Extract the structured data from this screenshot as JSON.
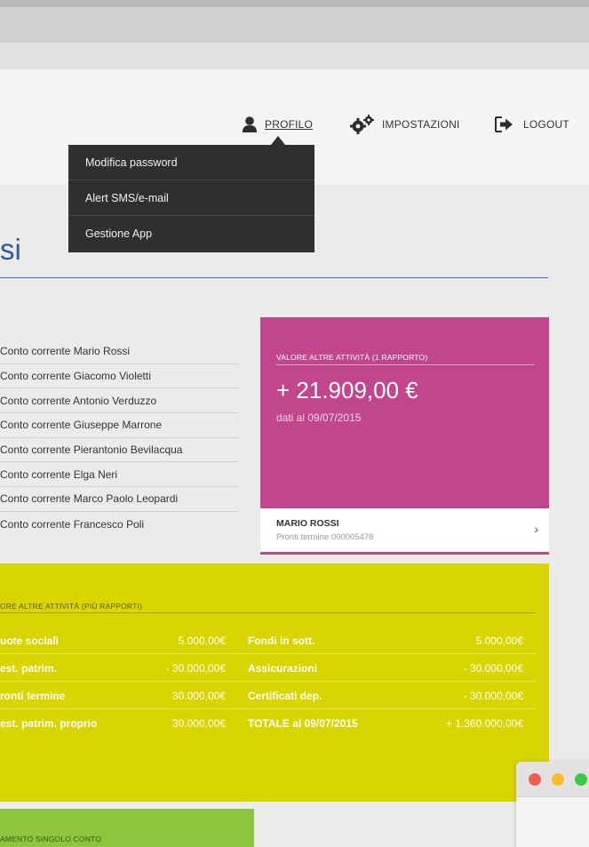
{
  "nav": {
    "profilo": "PROFILO",
    "impostazioni": "IMPOSTAZIONI",
    "logout": "LOGOUT"
  },
  "dropdown": {
    "items": [
      "Modifica password",
      "Alert SMS/e-mail",
      "Gestione App"
    ]
  },
  "page": {
    "title": "si"
  },
  "accounts": [
    "Conto corrente Mario Rossi",
    "Conto corrente Giacomo Violetti",
    "Conto corrente Antonio Verduzzo",
    "Conto corrente Giuseppe Marrone",
    "Conto corrente Pierantonio Bevilacqua",
    "Conto corrente Elga Neri",
    "Conto corrente Marco Paolo Leopardi",
    "Conto corrente Francesco Poli"
  ],
  "card": {
    "label": "VALORE ALTRE ATTIVITÀ (1 RAPPORTO)",
    "value": "+ 21.909,00 €",
    "date": "dati al 09/07/2015",
    "name": "MARIO ROSSI",
    "sub": "Pronti termine 000005478",
    "chevron": "›",
    "color": "#c2468b"
  },
  "panel_yellow": {
    "label": "ORE ALTRE ATTIVITÀ (PIÙ RAPPORTI)",
    "color": "#d9d500",
    "rows": [
      {
        "l1": "uote sociali",
        "v1": "5.000,00€",
        "l2": "Fondi in sott.",
        "v2": "5.000,00€"
      },
      {
        "l1": "est. patrim.",
        "v1": "- 30.000,00€",
        "l2": "Assicurazioni",
        "v2": "- 30.000,00€"
      },
      {
        "l1": "ronti termine",
        "v1": "30.000,00€",
        "l2": "Certificati dep.",
        "v2": "- 30.000,00€"
      },
      {
        "l1": "est. patrim. proprio",
        "v1": "30.000,00€",
        "l2": "TOTALE al 09/07/2015",
        "v2": "+ 1.360.000,00€"
      }
    ]
  },
  "panel_green": {
    "label": "AMENTO SINGOLO CONTO",
    "color": "#8cc63e"
  },
  "icons": {
    "profilo": "user-icon",
    "impostazioni": "gears-icon",
    "logout": "logout-icon"
  }
}
